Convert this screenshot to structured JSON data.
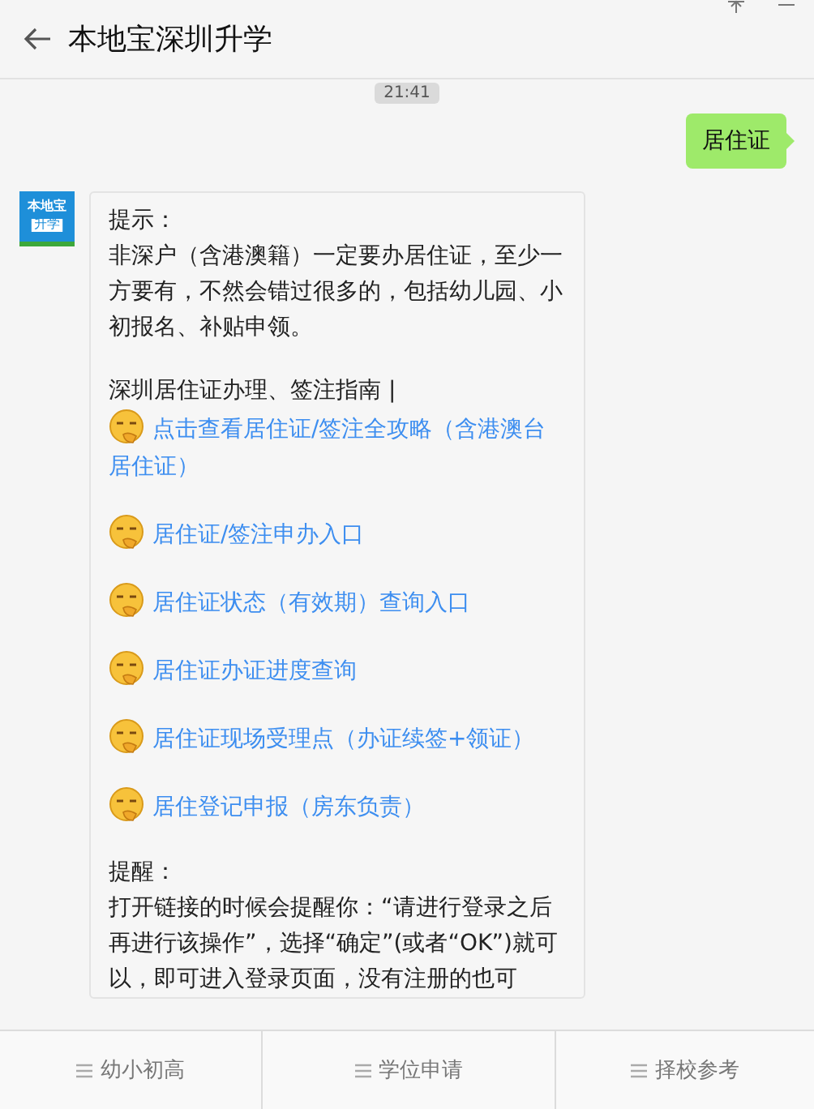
{
  "window": {
    "title": "本地宝深圳升学"
  },
  "timestamp": "21:41",
  "outgoing": {
    "text": "居住证"
  },
  "incoming": {
    "avatar": {
      "top": "本地宝",
      "bottom": "升学"
    },
    "groups": [
      [
        {
          "kind": "text",
          "text": "提示："
        },
        {
          "kind": "text",
          "text": "非深户（含港澳籍）一定要办居住证，至少一方要有，不然会错过很多的，包括幼儿园、小初报名、补贴申领。"
        }
      ],
      [
        {
          "kind": "text",
          "text": "深圳居住证办理、签注指南 |"
        },
        {
          "kind": "link",
          "text": "点击查看居住证/签注全攻略（含港澳台居住证）"
        }
      ],
      [
        {
          "kind": "link",
          "text": "居住证/签注申办入口"
        }
      ],
      [
        {
          "kind": "link",
          "text": "居住证状态（有效期）查询入口"
        }
      ],
      [
        {
          "kind": "link",
          "text": "居住证办证进度查询"
        }
      ],
      [
        {
          "kind": "link",
          "text": "居住证现场受理点（办证续签+领证）"
        }
      ],
      [
        {
          "kind": "link",
          "text": "居住登记申报（房东负责）"
        }
      ],
      [
        {
          "kind": "text",
          "text": "提醒："
        },
        {
          "kind": "text",
          "text": "打开链接的时候会提醒你：“请进行登录之后再进行该操作”，选择“确定”(或者“OK”)就可以，即可进入登录页面，没有注册的也可"
        }
      ]
    ]
  },
  "menu": [
    {
      "label": "幼小初高"
    },
    {
      "label": "学位申请"
    },
    {
      "label": "择校参考"
    }
  ]
}
